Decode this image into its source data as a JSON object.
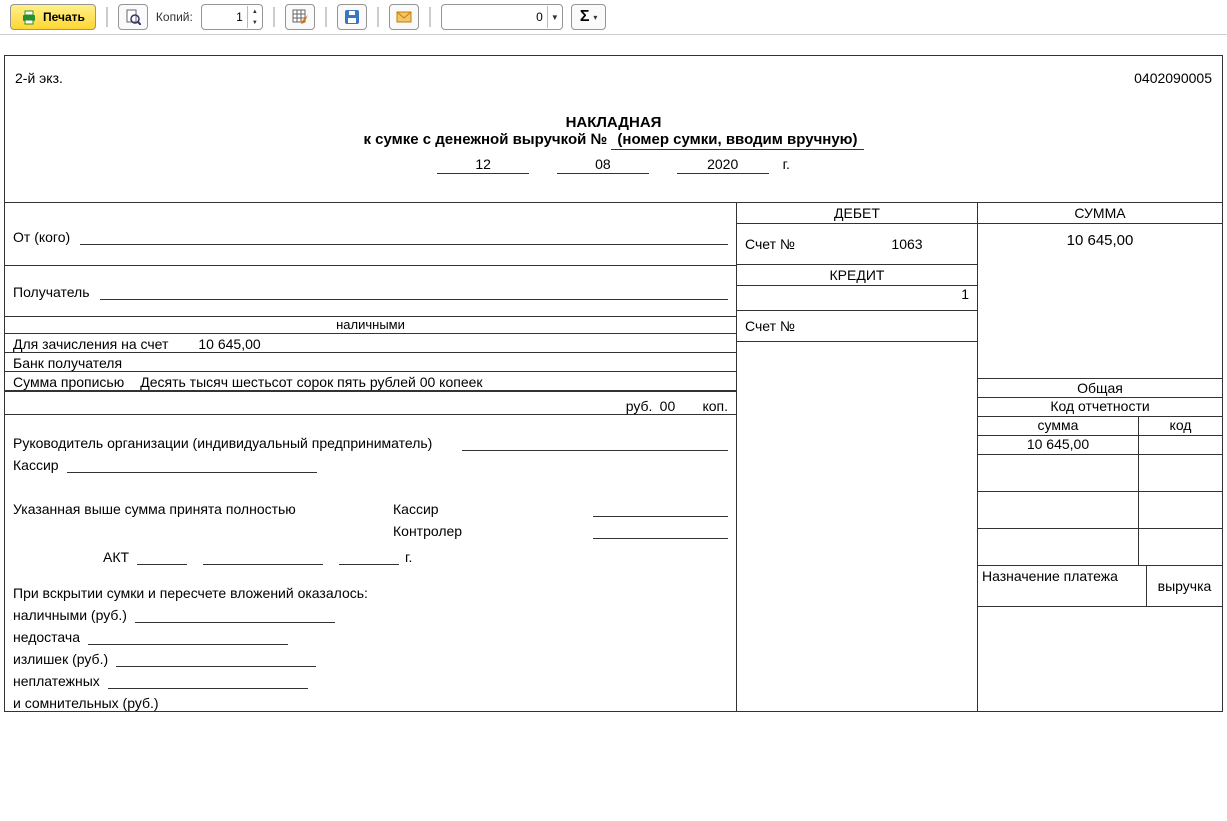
{
  "toolbar": {
    "print_label": "Печать",
    "copies_label": "Копий:",
    "copies_value": "1",
    "number_value": "0",
    "sigma": "Σ"
  },
  "doc": {
    "code": "0402090005",
    "exz": "2-й экз.",
    "title": "НАКЛАДНАЯ",
    "subtitle_prefix": "к сумке с денежной выручкой №",
    "bag_no": "(номер сумки, вводим вручную)",
    "date_day": "12",
    "date_month": "08",
    "date_year": "2020",
    "date_suffix": "г.",
    "from_label": "От (кого)",
    "recipient_label": "Получатель",
    "cash_label": "наличными",
    "credit_to_label": "Для зачисления на счет",
    "credit_amount": "10 645,00",
    "bank_label": "Банк получателя",
    "sum_words_label": "Сумма прописью",
    "sum_words_value": "Десять тысяч шестьсот сорок пять рублей 00 копеек",
    "rub": "руб.",
    "rub_val": "00",
    "kop": "коп.",
    "debit_header": "ДЕБЕТ",
    "credit_header": "КРЕДИТ",
    "account_label": "Счет №",
    "debit_account": "1063",
    "credit_account": "",
    "credit_one": "1",
    "sum_header": "СУММА",
    "sum_value": "10 645,00",
    "total_label": "Общая",
    "report_code_label": "Код отчетности",
    "col_sum_label": "сумма",
    "col_code_label": "код",
    "total_sum_value": "10 645,00",
    "purpose_label": "Назначение платежа",
    "purpose_value": "выручка",
    "manager_label": "Руководитель организации (индивидуальный предприниматель)",
    "cashier_label": "Кассир",
    "accepted_label": "Указанная выше сумма принята полностью",
    "cashier2_label": "Кассир",
    "controller_label": "Контролер",
    "act_label": "АКТ",
    "act_suffix": "г.",
    "open_label": "При вскрытии сумки и пересчете вложений оказалось:",
    "line_cash": "наличными (руб.)",
    "line_short": "недостача",
    "line_excess": "излишек (руб.)",
    "line_nonpay": "неплатежных",
    "line_doubt": "и сомнительных (руб.)"
  }
}
